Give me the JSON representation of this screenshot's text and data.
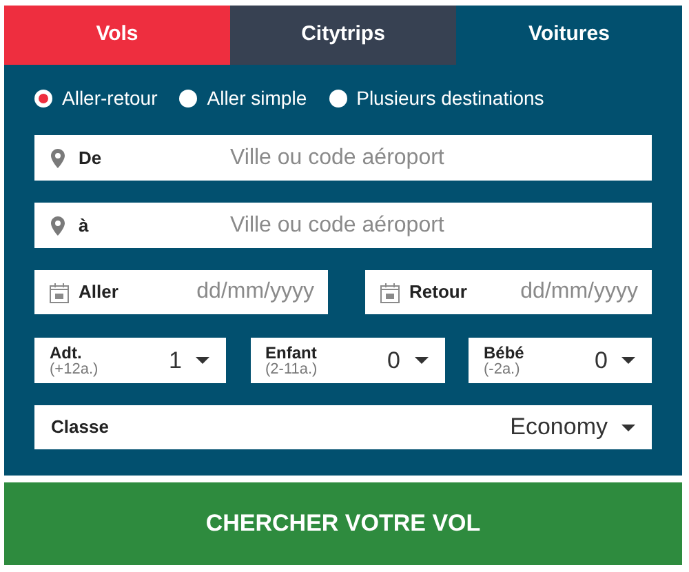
{
  "tabs": [
    {
      "label": "Vols",
      "color": "#ee2e3f"
    },
    {
      "label": "Citytrips",
      "color": "#374152"
    },
    {
      "label": "Voitures",
      "color": "#02506f"
    }
  ],
  "trip_types": [
    {
      "label": "Aller-retour",
      "selected": true
    },
    {
      "label": "Aller simple",
      "selected": false
    },
    {
      "label": "Plusieurs destinations",
      "selected": false
    }
  ],
  "origin": {
    "label": "De",
    "placeholder": "Ville ou code aéroport"
  },
  "destination": {
    "label": "à",
    "placeholder": "Ville ou code aéroport"
  },
  "dates": [
    {
      "label": "Aller",
      "placeholder": "dd/mm/yyyy"
    },
    {
      "label": "Retour",
      "placeholder": "dd/mm/yyyy"
    }
  ],
  "passengers": [
    {
      "label": "Adt.",
      "note": "(+12a.)",
      "value": "1"
    },
    {
      "label": "Enfant",
      "note": "(2-11a.)",
      "value": "0"
    },
    {
      "label": "Bébé",
      "note": "(-2a.)",
      "value": "0"
    }
  ],
  "class": {
    "label": "Classe",
    "value": "Economy"
  },
  "search_button": "CHERCHER VOTRE VOL"
}
